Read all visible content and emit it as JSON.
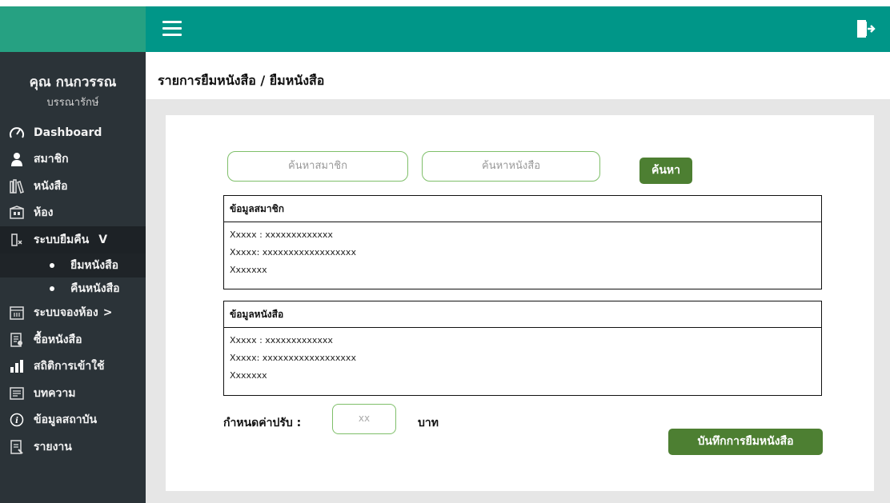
{
  "header": {
    "menu_icon": "hamburger-icon",
    "logout_icon": "logout-icon"
  },
  "user": {
    "name": "คุณ กนกวรรณ",
    "subtitle": "บรรณารักษ์"
  },
  "sidebar": {
    "items": [
      {
        "label": "Dashboard",
        "icon": "speedometer-icon"
      },
      {
        "label": "สมาชิก",
        "icon": "user-icon"
      },
      {
        "label": "หนังสือ",
        "icon": "books-icon"
      },
      {
        "label": "ห้อง",
        "icon": "room-icon"
      },
      {
        "label": "ระบบยืมคืน",
        "icon": "borrow-icon",
        "suffix": "V"
      }
    ],
    "sub_items": [
      {
        "label": "ยืมหนังสือ"
      },
      {
        "label": "คืนหนังสือ"
      }
    ],
    "items2": [
      {
        "label": "ระบบจองห้อง",
        "icon": "calendar-icon",
        "suffix": ">"
      },
      {
        "label": "ซื้อหนังสือ",
        "icon": "purchase-icon"
      },
      {
        "label": "สถิติการเข้าใช้",
        "icon": "bar-chart-icon"
      },
      {
        "label": "บทความ",
        "icon": "article-icon"
      },
      {
        "label": "ข้อมูลสถาบัน",
        "icon": "info-icon"
      },
      {
        "label": "รายงาน",
        "icon": "report-icon"
      }
    ]
  },
  "page": {
    "title": "รายการยืมหนังสือ / ยืมหนังสือ"
  },
  "search": {
    "member_placeholder": "ค้นหาสมาชิก",
    "book_placeholder": "ค้นหาหนังสือ",
    "button": "ค้นหา"
  },
  "member_info": {
    "title": "ข้อมูลสมาชิก",
    "rows": [
      "Xxxxx : xxxxxxxxxxxxx",
      "Xxxxx: xxxxxxxxxxxxxxxxxx",
      "Xxxxxxx"
    ]
  },
  "book_info": {
    "title": "ข้อมูลหนังสือ",
    "rows": [
      "Xxxxx : xxxxxxxxxxxxx",
      "Xxxxx: xxxxxxxxxxxxxxxxxx",
      "Xxxxxxx"
    ]
  },
  "fine": {
    "label": "กำหนดค่าปรับ :",
    "placeholder": "xx",
    "unit": "บาท"
  },
  "save_button": "บันทึกการยืมหนังสือ",
  "colors": {
    "topbar": "#009688",
    "sidebar": "#2b3338",
    "accent_button": "#4d7f32",
    "input_border": "#7fbf6a"
  }
}
